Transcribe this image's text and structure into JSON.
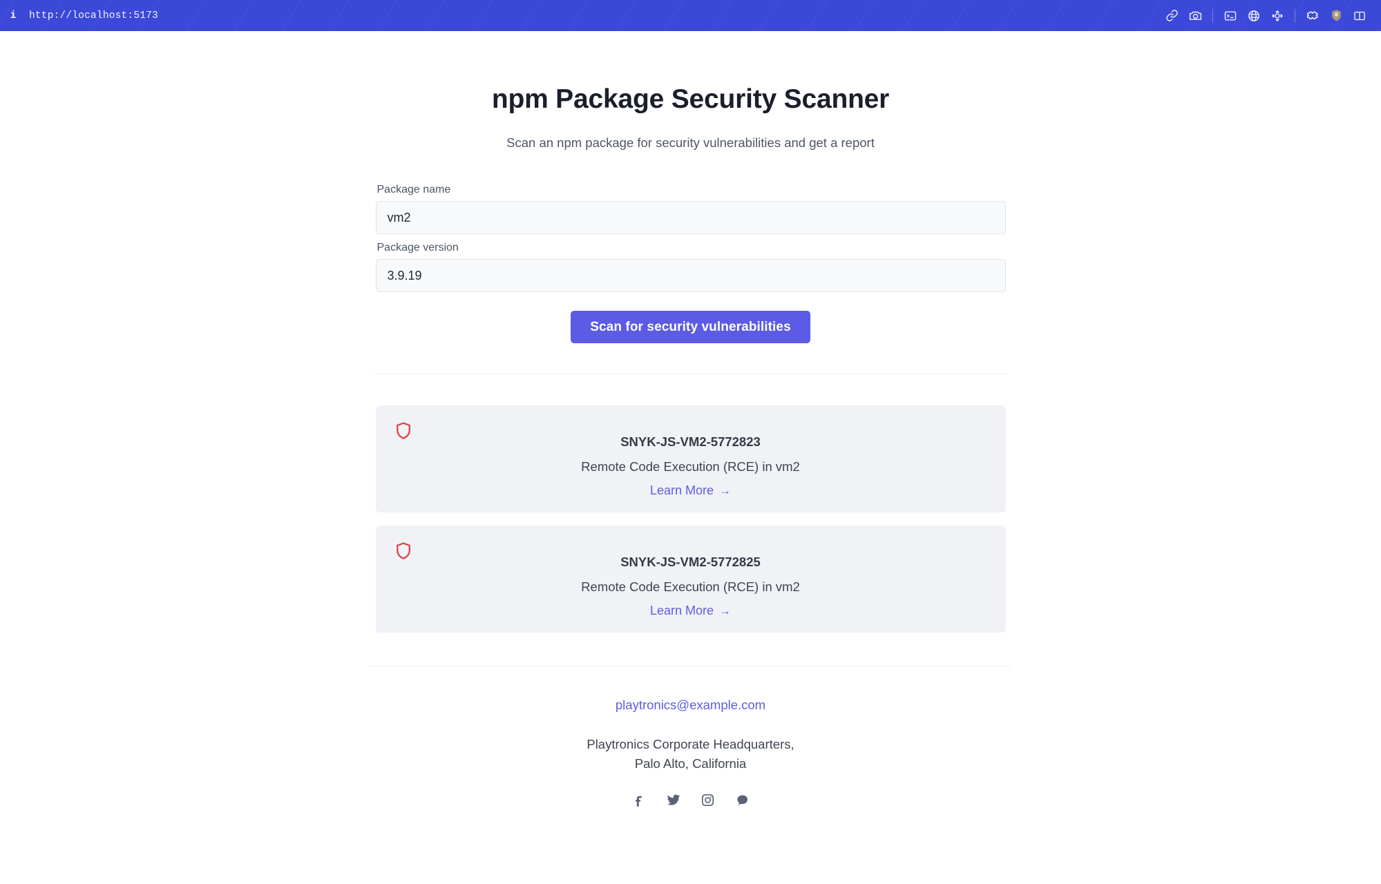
{
  "browser": {
    "info_glyph": "i",
    "url": "http://localhost:5173",
    "toolbar_icons": [
      {
        "name": "link-icon",
        "label": "Copy link"
      },
      {
        "name": "camera-icon",
        "label": "Screenshot"
      },
      {
        "name": "terminal-icon",
        "label": "Console"
      },
      {
        "name": "globe-icon",
        "label": "Network"
      },
      {
        "name": "target-icon",
        "label": "Inspect element"
      },
      {
        "name": "puzzle-icon",
        "label": "Extensions"
      },
      {
        "name": "shield-badge-icon",
        "label": "Protection"
      },
      {
        "name": "split-panel-icon",
        "label": "Toggle panel"
      }
    ]
  },
  "page": {
    "title": "npm Package Security Scanner",
    "subtitle": "Scan an npm package for security vulnerabilities and get a report"
  },
  "form": {
    "package_name": {
      "label": "Package name",
      "value": "vm2",
      "placeholder": "Package name"
    },
    "package_version": {
      "label": "Package version",
      "value": "3.9.19",
      "placeholder": "Package version"
    },
    "submit_label": "Scan for security vulnerabilities"
  },
  "results": {
    "link_label": "Learn More",
    "link_arrow": "→",
    "vulnerabilities": [
      {
        "id": "SNYK-JS-VM2-5772823",
        "description": "Remote Code Execution (RCE) in vm2",
        "severity_color": "#d94a54"
      },
      {
        "id": "SNYK-JS-VM2-5772825",
        "description": "Remote Code Execution (RCE) in vm2",
        "severity_color": "#d94a54"
      }
    ]
  },
  "footer": {
    "email": "playtronics@example.com",
    "address_line1": "Playtronics Corporate Headquarters,",
    "address_line2": "Palo Alto, California",
    "social": [
      {
        "name": "facebook-icon",
        "label": "Facebook"
      },
      {
        "name": "twitter-icon",
        "label": "Twitter"
      },
      {
        "name": "instagram-icon",
        "label": "Instagram"
      },
      {
        "name": "chat-bubble-icon",
        "label": "Chat"
      }
    ]
  },
  "colors": {
    "chrome_bar": "#3b48d8",
    "accent": "#5b5be6",
    "link": "#5d5ce0",
    "card_bg": "#f1f2f5",
    "danger": "#d94a54"
  }
}
